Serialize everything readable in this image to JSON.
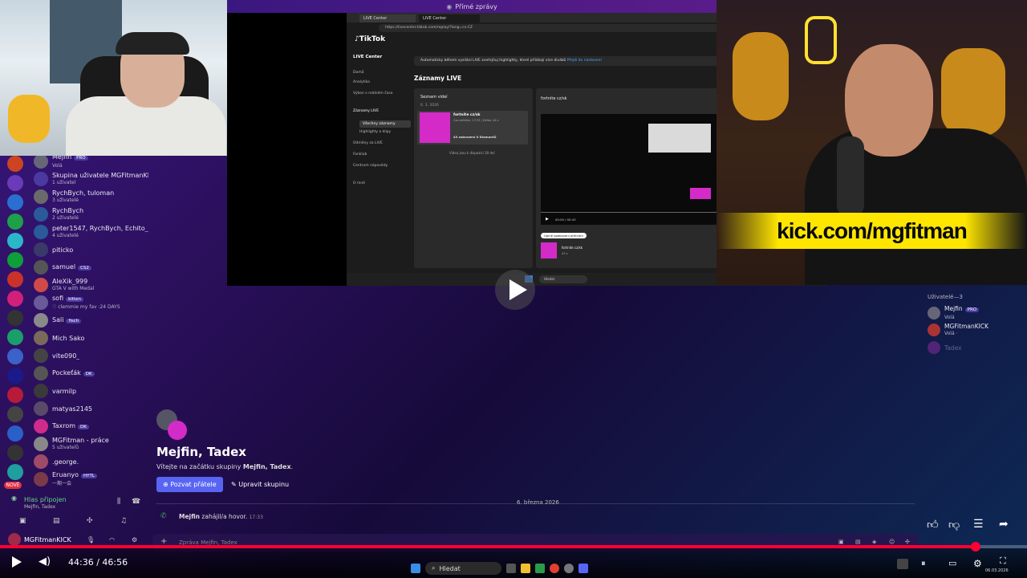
{
  "topbar": {
    "title": "Přímé zprávy"
  },
  "dms": [
    {
      "name": "Mejfin",
      "tag": "PRO",
      "sub": "Volá"
    },
    {
      "name": "Skupina uživatele MGFitmanKICK",
      "sub": "1 uživatel"
    },
    {
      "name": "RychBych, tuloman",
      "sub": "3 uživatelé"
    },
    {
      "name": "RychBych",
      "sub": "2 uživatelé"
    },
    {
      "name": "peter1547, RychBych, Echito_LI...",
      "sub": "4 uživatelé"
    },
    {
      "name": "piticko",
      "sub": ""
    },
    {
      "name": "samuel",
      "tag": "CS2",
      "sub": ""
    },
    {
      "name": "AleXik_999",
      "sub": "GTA V with Medal"
    },
    {
      "name": "sofi",
      "tag": "kitten",
      "sub": "♡ clemmie my fav :24 DAYS"
    },
    {
      "name": "Sali",
      "tag": "fisch",
      "sub": ""
    },
    {
      "name": "Mich Sako",
      "sub": ""
    },
    {
      "name": "vite090_",
      "sub": ""
    },
    {
      "name": "Pockeťák",
      "tag": "DK",
      "sub": ""
    },
    {
      "name": "varmilp",
      "sub": ""
    },
    {
      "name": "matyas2145",
      "sub": ""
    },
    {
      "name": "Taxrom",
      "tag": "DK",
      "sub": ""
    },
    {
      "name": "MGFitman - práce",
      "sub": "5 uživatelů"
    },
    {
      "name": ".george.",
      "sub": ""
    },
    {
      "name": "Eruanyo",
      "tag": "HYTL",
      "sub": "一期一会"
    }
  ],
  "voice": {
    "status": "Hlas připojen",
    "channel": "Mejfin, Tadex",
    "user": "MGFitmanKICK"
  },
  "servers": {
    "new_label": "NOVÉ"
  },
  "browser": {
    "tab1": "LIVE Center",
    "tab2": "LIVE Center",
    "url": "https://livecenter.tiktok.com/replay/?lang=cs-CZ",
    "brand": "TikTok",
    "section": "LIVE Center",
    "nav": [
      "Domů",
      "Analytika",
      "Výkon v reálném čase",
      "Záznamy LIVE",
      "Všechny záznamy",
      "Highlighty a klipy",
      "Odměny za LIVE",
      "Fanklub",
      "Centrum nápovědy",
      "O mně"
    ],
    "banner": "Automaticky během vysílání LIVE zveřejňuj highlighty, které přilákají více diváků",
    "banner_link": "Přejdi do nastavení",
    "heading": "Záznamy LIVE",
    "list_title": "Seznam videí",
    "date": "6. 3. 2026",
    "video_title": "fortnite cz/sk",
    "video_meta": "Čas začátku: 17:33 | Délka: 44 s",
    "video_stats": "43 zobrazení  0 Diamantů",
    "list_note": "Videa jsou k dispozici 30 dní",
    "player_title": "fortnite cz/sk",
    "player_time": "00:00 / 00:43",
    "chip": "Úplné opakovaní přehrání",
    "clip_title": "fortnite cz/sk",
    "clip_meta": "43 s",
    "taskbar_search": "Hledat",
    "clock": "17:38",
    "date2": "06.03.2026"
  },
  "overlay": {
    "kick": "kick.com/mgfitman"
  },
  "channel": {
    "name": "Mejfin, Tadex",
    "welcome_pre": "Vítejte na začátku skupiny ",
    "welcome_name": "Mejfin, Tadex",
    "welcome_post": ".",
    "invite": "Pozvat přátele",
    "edit": "Upravit skupinu",
    "divider_date": "6. března 2026",
    "call_user": "Mejfin",
    "call_text": "zahájil/a hovor.",
    "call_time": "17:33",
    "input_placeholder": "Zpráva Mejfin, Tadex"
  },
  "members": {
    "header": "Uživatelé—3",
    "list": [
      {
        "name": "Mejfin",
        "tag": "PRO",
        "sub": "Volá"
      },
      {
        "name": "MGFitmanKICK",
        "sub": "Volá ·"
      },
      {
        "name": "Tadex",
        "sub": ""
      }
    ]
  },
  "player": {
    "timecode": "44:36 / 46:56",
    "progress": 0.95
  },
  "taskbar": {
    "search": "Hledat",
    "clock": "06.03.2026"
  }
}
